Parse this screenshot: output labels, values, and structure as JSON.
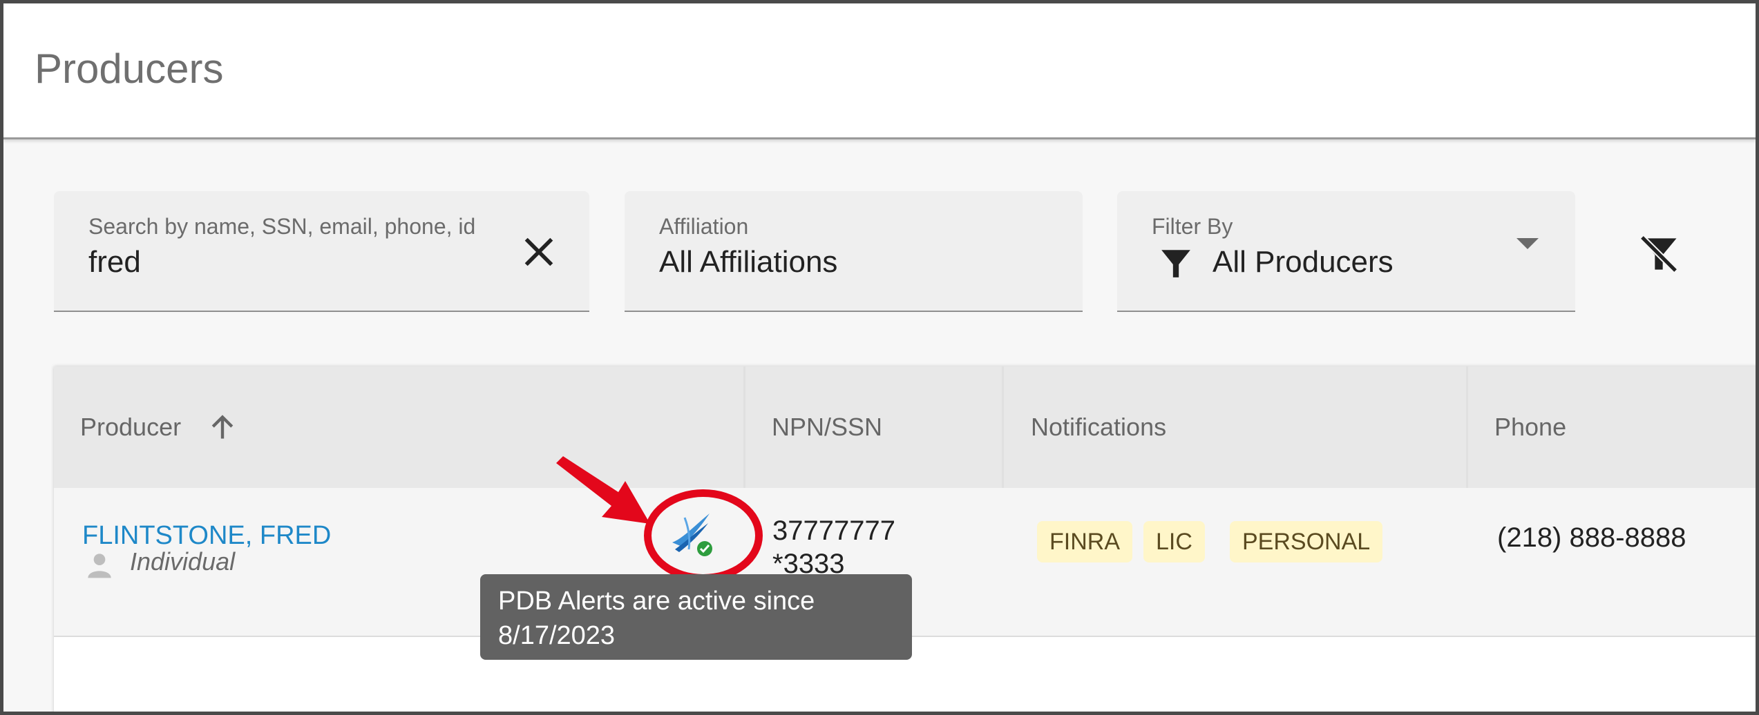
{
  "page": {
    "title": "Producers"
  },
  "search": {
    "label": "Search by name, SSN, email, phone, id",
    "value": "fred"
  },
  "affiliation": {
    "label": "Affiliation",
    "value": "All Affiliations"
  },
  "filter": {
    "label": "Filter By",
    "value": "All Producers"
  },
  "table": {
    "columns": [
      "Producer",
      "NPN/SSN",
      "Notifications",
      "Phone"
    ],
    "rows": [
      {
        "name": "FLINTSTONE, FRED",
        "type": "Individual",
        "npn": "37777777",
        "ssn": "*3333",
        "notifications": [
          "FINRA",
          "LIC",
          "PERSONAL"
        ],
        "phone": "(218) 888-8888"
      }
    ]
  },
  "tooltip": {
    "line1": "PDB Alerts are active since",
    "line2": "8/17/2023"
  },
  "colors": {
    "link": "#1e88c8",
    "tag_bg": "#fff6c9",
    "highlight": "#e3071b",
    "tooltip_bg": "#626262"
  }
}
